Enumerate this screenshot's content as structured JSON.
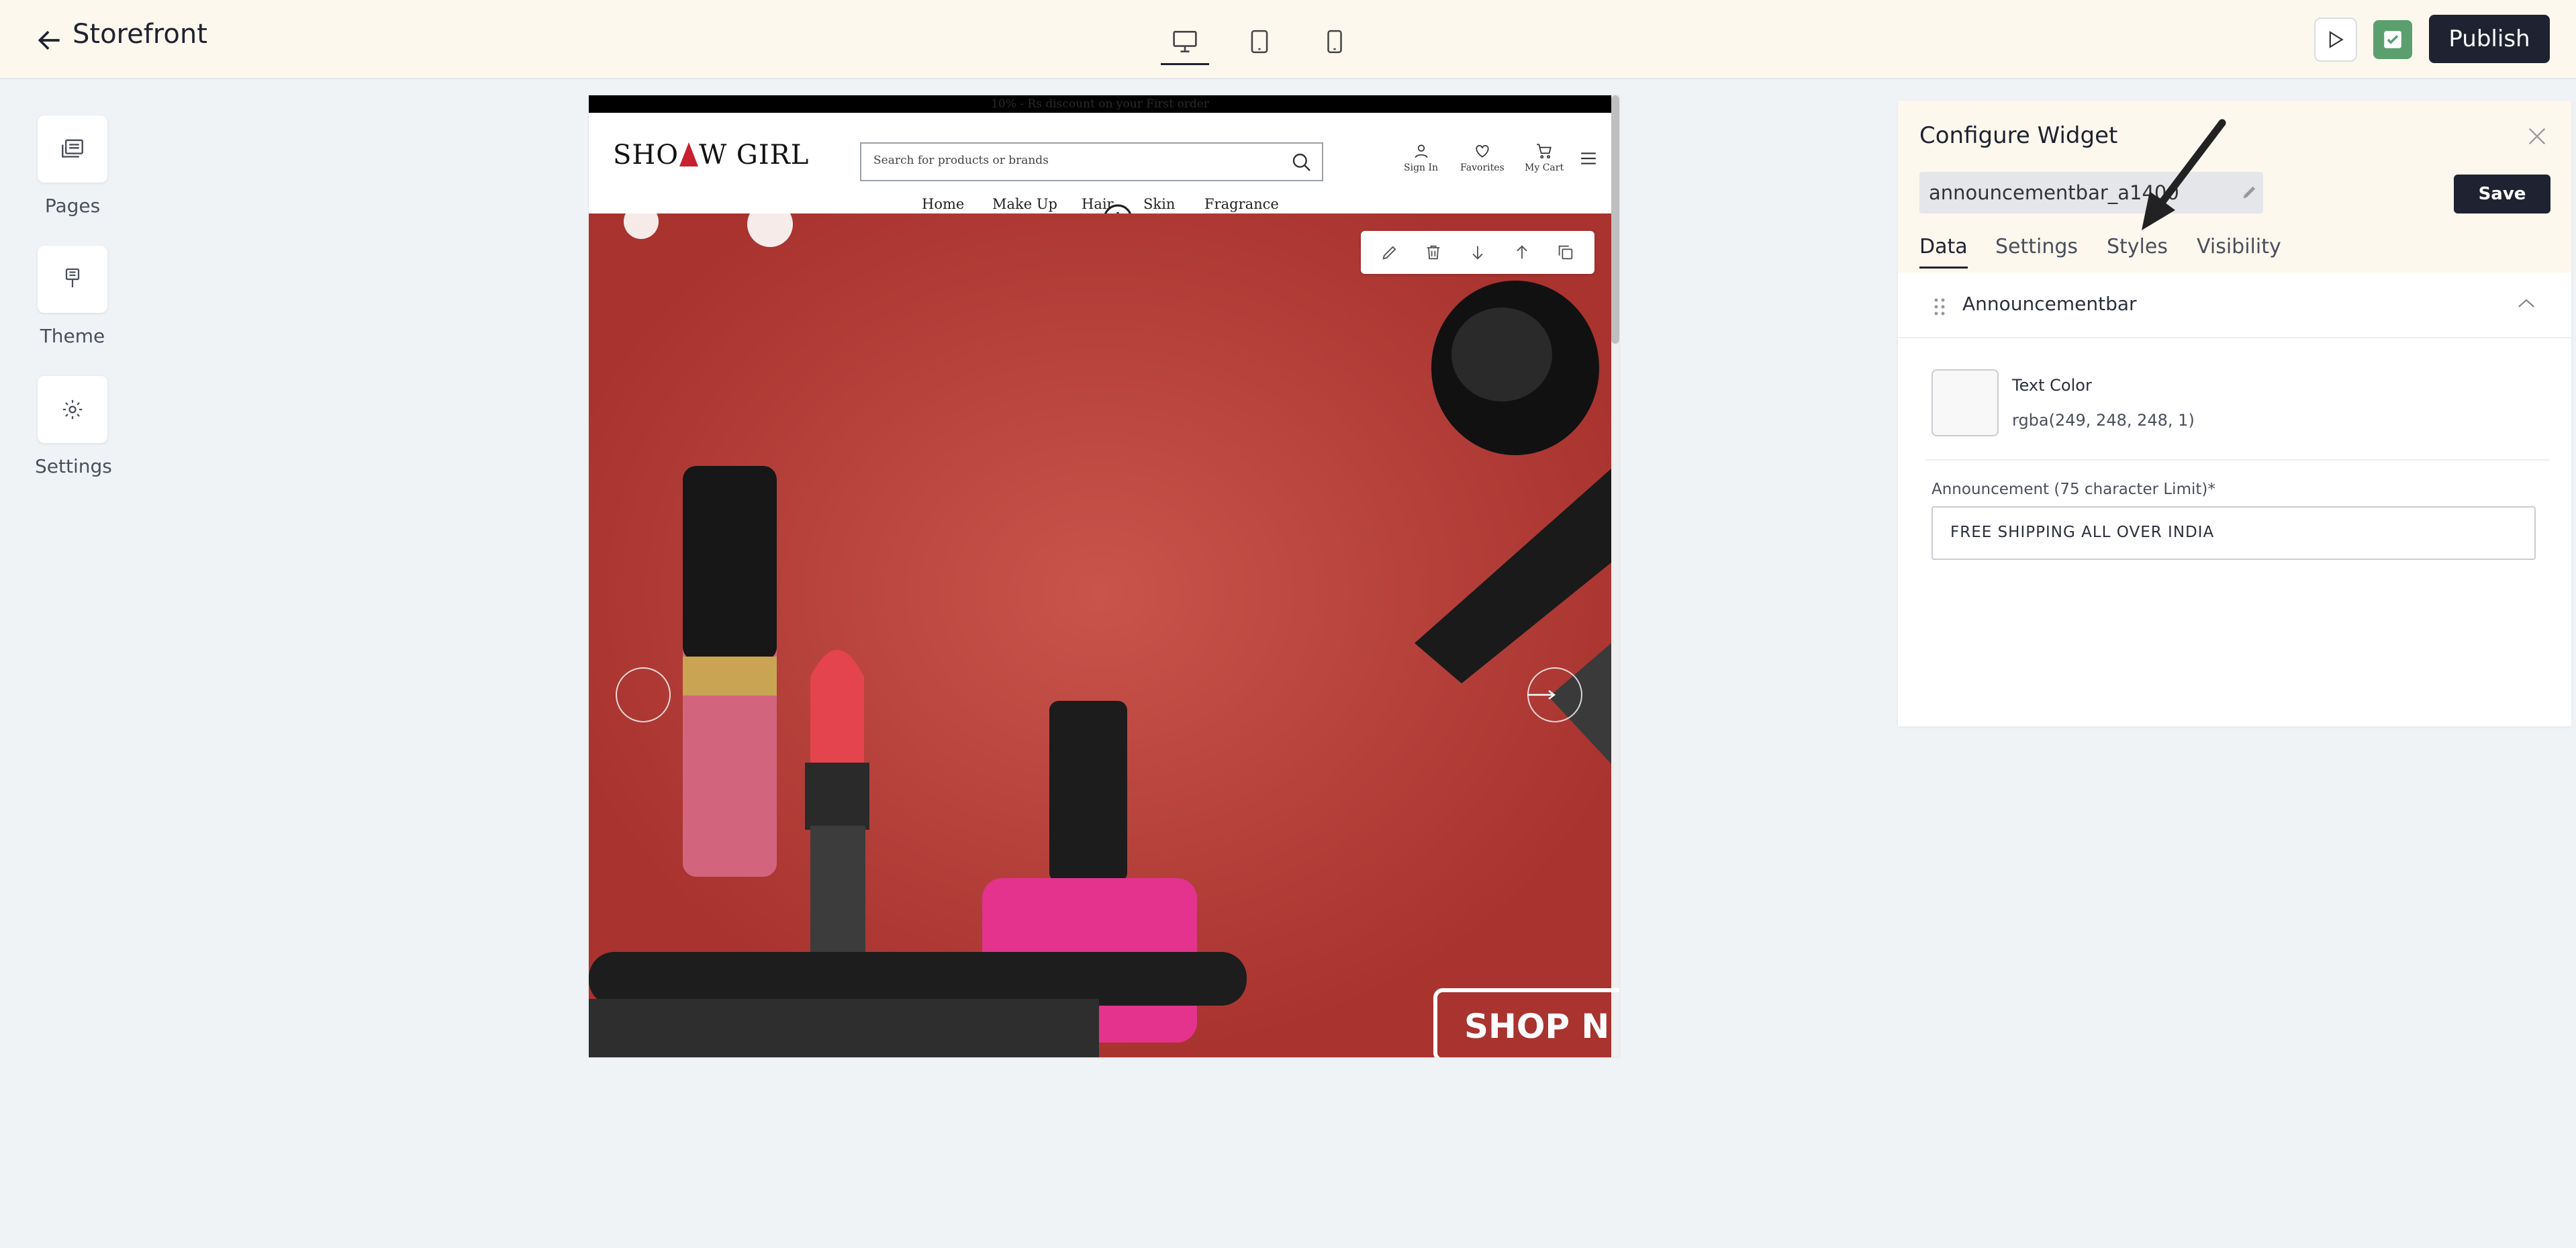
{
  "topbar": {
    "title": "Storefront",
    "devices": [
      "desktop",
      "tablet",
      "mobile"
    ],
    "active_device": "desktop",
    "publish_label": "Publish"
  },
  "rail": {
    "items": [
      {
        "label": "Pages",
        "icon": "pages-icon"
      },
      {
        "label": "Theme",
        "icon": "theme-icon"
      },
      {
        "label": "Settings",
        "icon": "gear-icon"
      }
    ]
  },
  "preview": {
    "announcement": "10% - Rs discount on your First order",
    "logo": {
      "left": "SHO",
      "right": "W GIRL"
    },
    "search_placeholder": "Search for products or brands",
    "header_icons": [
      "Sign In",
      "Favorites",
      "My Cart"
    ],
    "nav": [
      "Home",
      "Make Up",
      "Hair",
      "Skin",
      "Fragrance"
    ],
    "cta": "SHOP N"
  },
  "panel": {
    "title": "Configure Widget",
    "widget_name": "announcementbar_a1400",
    "save_label": "Save",
    "tabs": [
      "Data",
      "Settings",
      "Styles",
      "Visibility"
    ],
    "active_tab": "Data",
    "section_title": "Announcementbar",
    "text_color_label": "Text Color",
    "text_color_value": "rgba(249, 248, 248, 1)",
    "announcement_label": "Announcement (75 character Limit)*",
    "announcement_value": "FREE SHIPPING ALL OVER INDIA"
  },
  "colors": {
    "accent": "#1f2230",
    "topbar_bg": "#fdf8ee",
    "check": "#5c9f6e",
    "hero": "#c2453f"
  }
}
